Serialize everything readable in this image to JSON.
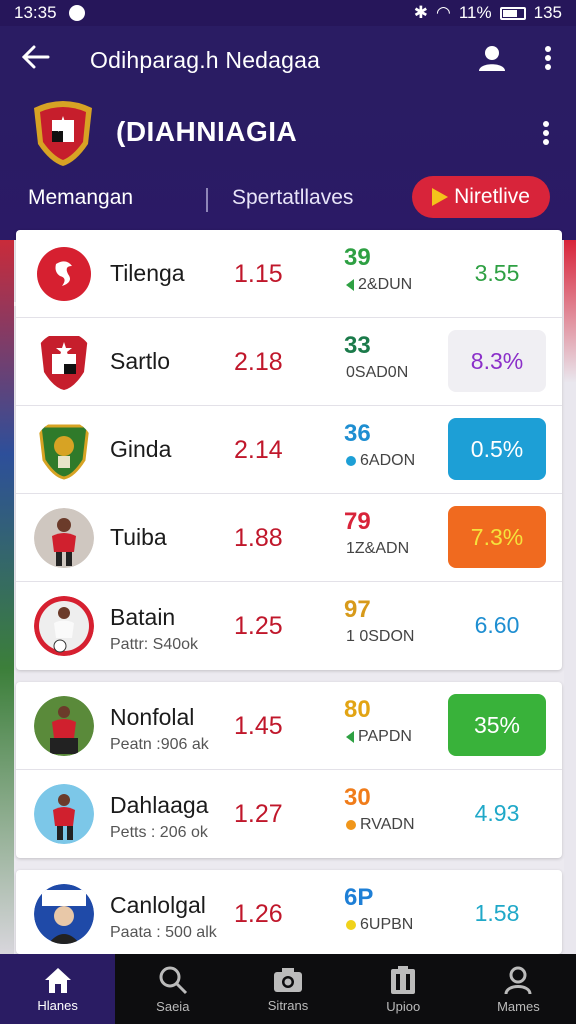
{
  "status_bar": {
    "time": "13:35",
    "battery": "11%",
    "right_time": "135"
  },
  "app_bar": {
    "title": "Odihparag.h Nedagaa"
  },
  "club": {
    "name": "(DIAHNIAGIA"
  },
  "tabs": [
    {
      "label": "Memangan"
    },
    {
      "label": "Spertatllaves"
    }
  ],
  "live_button": {
    "label": "Niretlive"
  },
  "colors": {
    "primary": "#2a1c63",
    "accent": "#d8243a"
  },
  "rows": [
    {
      "name": "Tilenga",
      "sub": "",
      "odds": "1.15",
      "stat": "39",
      "stat_sub": "2&DUN",
      "stat_color": "#2ea043",
      "marker": "triangle-green",
      "value": "3.55",
      "value_color": "#2ea043",
      "pill_bg": ""
    },
    {
      "name": "Sartlo",
      "sub": "",
      "odds": "2.18",
      "stat": "33",
      "stat_sub": "0SAD0N",
      "stat_color": "#1b7a4a",
      "marker": "",
      "value": "8.3%",
      "value_color": "#8b2fc9",
      "pill_bg": "#f0eff3"
    },
    {
      "name": "Ginda",
      "sub": "",
      "odds": "2.14",
      "stat": "36",
      "stat_sub": "6ADON",
      "stat_color": "#1e8ed1",
      "marker": "dot-blue",
      "value": "0.5%",
      "value_color": "#ffffff",
      "pill_bg": "#1d9fd6"
    },
    {
      "name": "Tuiba",
      "sub": "",
      "odds": "1.88",
      "stat": "79",
      "stat_sub": "1Z&ADN",
      "stat_color": "#d8243a",
      "marker": "",
      "value": "7.3%",
      "value_color": "#f5e23c",
      "pill_bg": "#f06a1f"
    },
    {
      "name": "Batain",
      "sub": "Pattr: S40ok",
      "odds": "1.25",
      "stat": "97",
      "stat_sub": "1 0SDON",
      "stat_color": "#d79a1a",
      "marker": "",
      "value": "6.60",
      "value_color": "#1e8ed1",
      "pill_bg": ""
    },
    {
      "name": "Nonfolal",
      "sub": "Peatn :906 ak",
      "odds": "1.45",
      "stat": "80",
      "stat_sub": "PAPDN",
      "stat_color": "#e2a414",
      "marker": "triangle-green",
      "value": "35%",
      "value_color": "#ffffff",
      "pill_bg": "#39b23a"
    },
    {
      "name": "Dahlaaga",
      "sub": "Petts : 206 ok",
      "odds": "1.27",
      "stat": "30",
      "stat_sub": "RVADN",
      "stat_color": "#f07c1a",
      "marker": "dot-orange",
      "value": "4.93",
      "value_color": "#1fa8c8",
      "pill_bg": ""
    },
    {
      "name": "Canlolgal",
      "sub": "Paata : 500 alk",
      "odds": "1.26",
      "stat": "6P",
      "stat_sub": "6UPBN",
      "stat_color": "#1e7fd6",
      "marker": "dot-yellow",
      "value": "1.58",
      "value_color": "#1fa8c8",
      "pill_bg": ""
    }
  ],
  "bottom_nav": [
    {
      "label": "Hlanes",
      "icon": "home-icon"
    },
    {
      "label": "Saeia",
      "icon": "search-icon"
    },
    {
      "label": "Sitrans",
      "icon": "camera-icon"
    },
    {
      "label": "Upioo",
      "icon": "clipboard-icon"
    },
    {
      "label": "Mames",
      "icon": "profile-icon"
    }
  ]
}
